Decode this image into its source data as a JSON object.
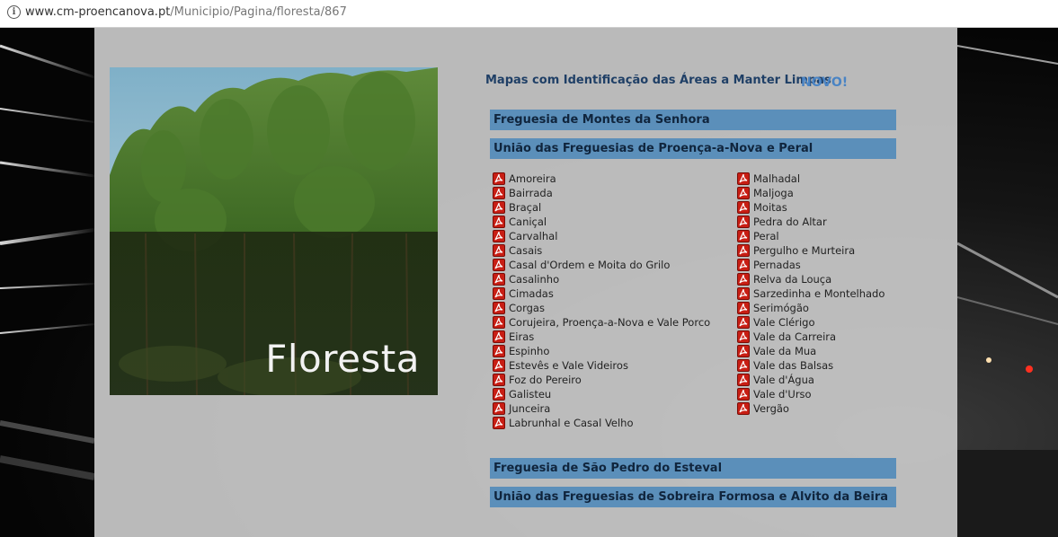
{
  "browser": {
    "url_domain": "www.cm-proencanova.pt",
    "url_path": "/Municipio/Pagina/floresta/867",
    "info_icon": "info-icon"
  },
  "hero": {
    "title": "Floresta"
  },
  "maps": {
    "title": "Mapas com Identificação das Áreas a Manter Limpas",
    "badge": "NOVO!"
  },
  "sections": [
    {
      "label": "Freguesia de Montes da Senhora"
    },
    {
      "label": "União das Freguesias de Proença-a-Nova e Peral"
    },
    {
      "label": "Freguesia de São Pedro do Esteval"
    },
    {
      "label": "União das Freguesias de Sobreira Formosa e Alvito da Beira"
    }
  ],
  "places_left": [
    "Amoreira",
    "Bairrada",
    "Braçal",
    "Caniçal",
    "Carvalhal",
    "Casais",
    "Casal d'Ordem e Moita do Grilo",
    "Casalinho",
    "Cimadas",
    "Corgas",
    "Corujeira, Proença-a-Nova e Vale Porco",
    "Eiras",
    "Espinho",
    "Estevês e Vale Videiros",
    "Foz do Pereiro",
    "Galisteu",
    "Junceira",
    "Labrunhal e Casal Velho"
  ],
  "places_right": [
    "Malhadal",
    "Maljoga",
    "Moitas",
    "Pedra do Altar",
    "Peral",
    "Pergulho e Murteira",
    "Pernadas",
    "Relva da Louça",
    "Sarzedinha e Montelhado",
    "Serimógão",
    "Vale Clérigo",
    "Vale da Carreira",
    "Vale da Mua",
    "Vale das Balsas",
    "Vale d'Água",
    "Vale d'Urso",
    "Vergão"
  ],
  "icons": {
    "pdf": "pdf-icon"
  },
  "colors": {
    "section_bar": "#5b8fba",
    "title": "#1f3f66",
    "novo": "#4a84c4",
    "pdf": "#c81e14"
  }
}
